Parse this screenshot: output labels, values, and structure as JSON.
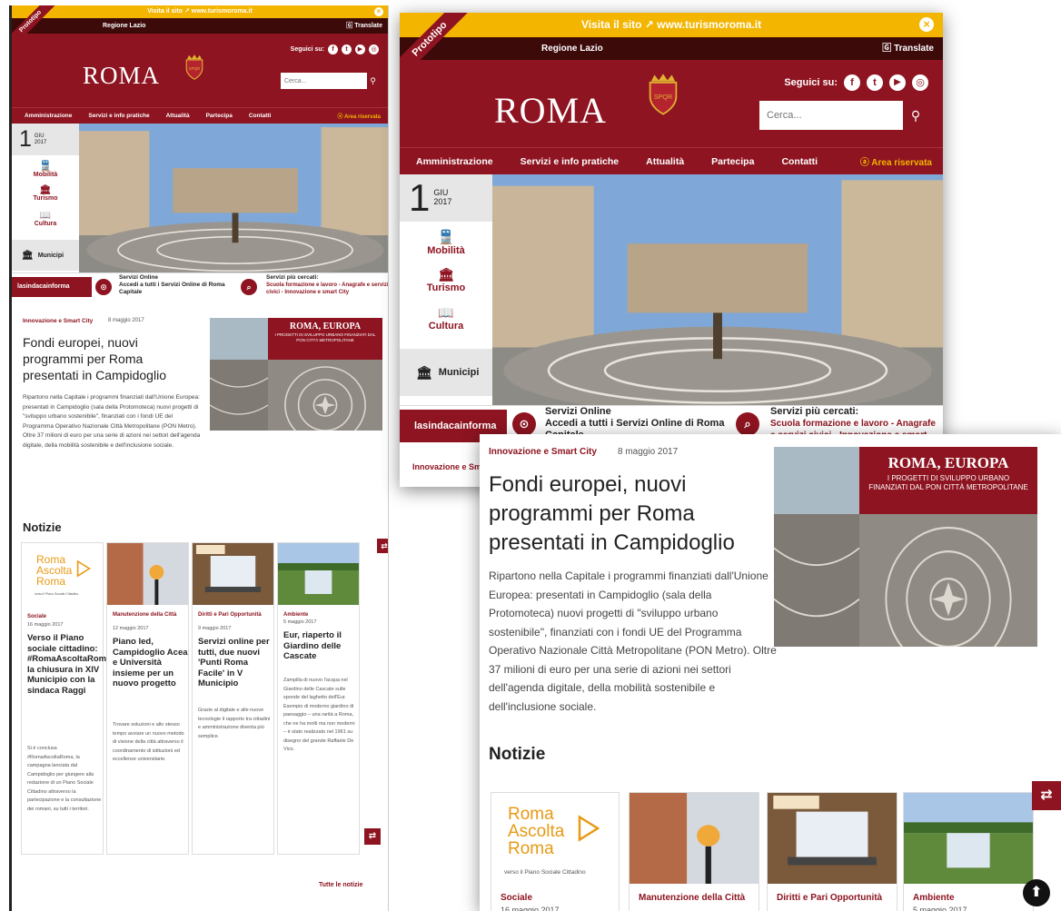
{
  "prototype_label": "Prototipo",
  "topbar": {
    "visit": "Visita il sito",
    "site": "www.turismoroma.it",
    "close": "×"
  },
  "region": "Regione Lazio",
  "translate": "Translate",
  "logo": "ROMA",
  "follow": "Seguici su:",
  "search_placeholder": "Cerca...",
  "search_button": "⚲",
  "nav": [
    "Amministrazione",
    "Servizi e info pratiche",
    "Attualità",
    "Partecipa",
    "Contatti"
  ],
  "reserved_area": "Area riservata",
  "date": {
    "day": "1",
    "month": "GIU",
    "year": "2017"
  },
  "sidebar": [
    "Mobilità",
    "Turismo",
    "Cultura"
  ],
  "municipi": "Municipi",
  "strip": {
    "sindaca": "lasindacainforma",
    "online_title": "Servizi Online",
    "online_text": "Accedi a tutti i Servizi Online di Roma Capitale",
    "searched_title": "Servizi più cercati:",
    "searched_text": "Scuola formazione e lavoro - Anagrafe e servizi civici - Innovazione e smart City"
  },
  "article": {
    "category": "Innovazione e Smart City",
    "date": "8 maggio 2017",
    "title": "Fondi europei, nuovi programmi per Roma presentati in Campidoglio",
    "body": "Ripartono nella Capitale i programmi finanziati dall'Unione Europea: presentati in Campidoglio (sala della Protomoteca) nuovi progetti di \"sviluppo urbano sostenibile\", finanziati con i fondi UE del Programma Operativo Nazionale Città Metropolitane (PON Metro). Oltre 37 milioni di euro per una serie di azioni nei settori dell'agenda digitale, della mobilità sostenibile e dell'inclusione sociale."
  },
  "poster": {
    "title": "ROMA, EUROPA",
    "subtitle": "I PROGETTI DI SVILUPPO URBANO FINANZIATI DAL PON CITTÀ METROPOLITANE"
  },
  "news_heading": "Notizie",
  "cards": [
    {
      "category": "Sociale",
      "date": "16 maggio 2017",
      "title": "Verso il Piano sociale cittadino: #RomaAscoltaRoma la chiusura in XIV Municipio con la sindaca Raggi",
      "text": "Si è conclusa #RomaAscoltaRoma, la campagna lanciata dal Campidoglio per giungere alla redazione di un Piano Sociale Cittadino attraverso la partecipazione e la consultazione dei romani, su tutti i territori."
    },
    {
      "category": "Manutenzione della Città",
      "date": "12 maggio 2017",
      "title": "Piano led, Campidoglio Acea e Università insieme per un nuovo progetto",
      "text": "Trovare soluzioni e allo stesso tempo avviare un nuovo metodo di visione della città attraverso il coordinamento di istituzioni ed eccellenze universitarie."
    },
    {
      "category": "Diritti e Pari Opportunità",
      "date": "9 maggio 2017",
      "title": "Servizi online per tutti, due nuovi 'Punti Roma Facile' in V Municipio",
      "text": "Grazie al digitale e alle nuove tecnologie il rapporto tra cittadini e amministrazione diventa più semplice."
    },
    {
      "category": "Ambiente",
      "date": "5 maggio 2017",
      "title": "Eur, riaperto il Giardino delle Cascate",
      "text": "Zampilla di nuovo l'acqua nel Giardino delle Cascate sulle sponde del laghetto dell'Eur. Esempio di moderno giardino di paesaggio – una rarità a Roma, che ne ha molti ma non moderni – è stato realizzato nel 1961 su disegno del grande Raffaele De Vico."
    }
  ],
  "roma_ascolta": {
    "l1": "Roma",
    "l2": "Ascolta",
    "l3": "Roma",
    "sub": "verso il Piano Sociale Cittadino"
  },
  "all_news": "Tutte le notizie",
  "shuffle": "⇄",
  "scroll_up": "⬆",
  "colors": {
    "brand": "#8d1420",
    "accent": "#f3b500",
    "dark": "#3d0a0a"
  }
}
